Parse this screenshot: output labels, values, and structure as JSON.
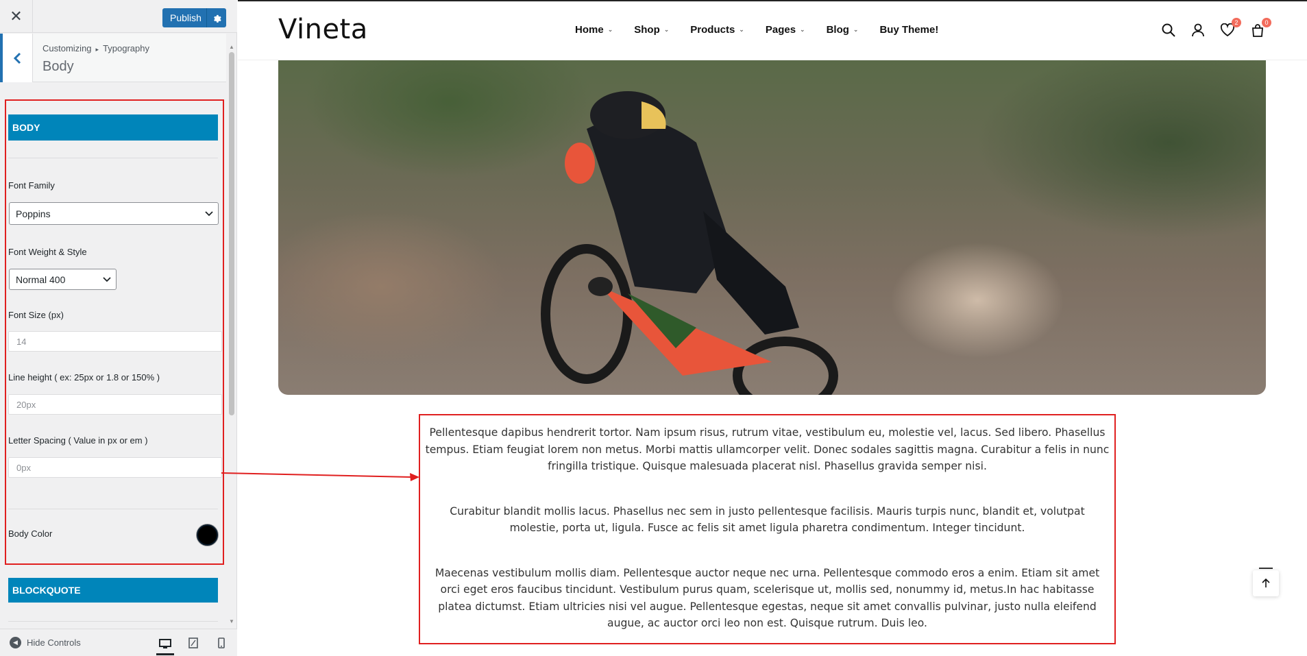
{
  "sidebar": {
    "publish_label": "Publish",
    "breadcrumb": {
      "root": "Customizing",
      "separator": "▸",
      "current": "Typography"
    },
    "section_title": "Body",
    "body_section": {
      "heading": "BODY",
      "font_family_label": "Font Family",
      "font_family_value": "Poppins",
      "font_weight_label": "Font Weight & Style",
      "font_weight_value": "Normal 400",
      "font_size_label": "Font Size (px)",
      "font_size_value": "14",
      "line_height_label": "Line height ( ex: 25px or 1.8 or 150% )",
      "line_height_value": "20px",
      "letter_spacing_label": "Letter Spacing ( Value in px or em )",
      "letter_spacing_value": "0px",
      "body_color_label": "Body Color",
      "body_color_value": "#000000"
    },
    "blockquote_heading": "BLOCKQUOTE",
    "footer": {
      "hide_controls_label": "Hide Controls"
    }
  },
  "site": {
    "logo": "Vineta",
    "nav": [
      {
        "label": "Home",
        "has_dropdown": true
      },
      {
        "label": "Shop",
        "has_dropdown": true
      },
      {
        "label": "Products",
        "has_dropdown": true
      },
      {
        "label": "Pages",
        "has_dropdown": true
      },
      {
        "label": "Blog",
        "has_dropdown": true
      },
      {
        "label": "Buy Theme!",
        "has_dropdown": false
      }
    ],
    "wishlist_count": "2",
    "cart_count": "0",
    "paragraphs": [
      "Pellentesque dapibus hendrerit tortor. Nam ipsum risus, rutrum vitae, vestibulum eu, molestie vel, lacus. Sed libero. Phasellus tempus. Etiam feugiat lorem non metus. Morbi mattis ullamcorper velit. Donec sodales sagittis magna. Curabitur a felis in nunc fringilla tristique. Quisque malesuada placerat nisl. Phasellus gravida semper nisi.",
      "Curabitur blandit mollis lacus. Phasellus nec sem in justo pellentesque facilisis. Mauris turpis nunc, blandit et, volutpat molestie, porta ut, ligula. Fusce ac felis sit amet ligula pharetra condimentum. Integer tincidunt.",
      "Maecenas vestibulum mollis diam. Pellentesque auctor neque nec urna. Pellentesque commodo eros a enim. Etiam sit amet orci eget eros faucibus tincidunt. Vestibulum purus quam, scelerisque ut, mollis sed, nonummy id, metus.In hac habitasse platea dictumst. Etiam ultricies nisi vel augue. Pellentesque egestas, neque sit amet convallis pulvinar, justo nulla eleifend augue, ac auctor orci leo non est. Quisque rutrum. Duis leo."
    ]
  },
  "colors": {
    "accent": "#0085ba",
    "publish": "#2271b1",
    "highlight": "#e01f1f",
    "badge": "#f26b5b"
  }
}
